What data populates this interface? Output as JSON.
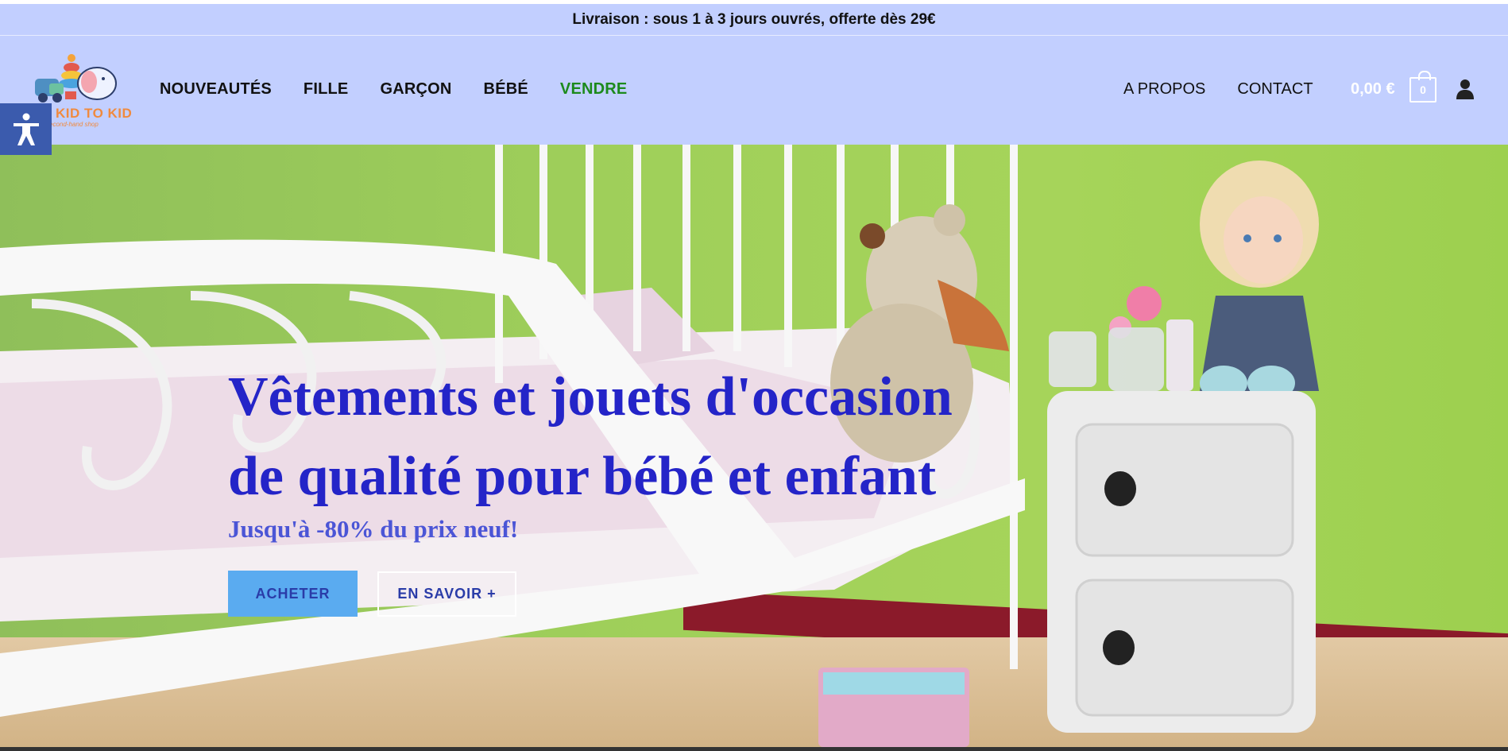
{
  "announcement": "Livraison : sous 1 à 3 jours ouvrés, offerte dès 29€",
  "logo": {
    "text": "KID TO KID",
    "subtitle": "second-hand shop"
  },
  "nav_left": [
    {
      "label": "NOUVEAUTÉS"
    },
    {
      "label": "FILLE"
    },
    {
      "label": "GARÇON"
    },
    {
      "label": "BÉBÉ"
    },
    {
      "label": "VENDRE"
    }
  ],
  "nav_right": [
    {
      "label": "A PROPOS"
    },
    {
      "label": "CONTACT"
    }
  ],
  "cart": {
    "total": "0,00 €",
    "count": "0"
  },
  "icons": {
    "accessibility": "accessibility-icon",
    "cart": "shopping-bag-icon",
    "user": "user-icon"
  },
  "hero": {
    "title_line1": "Vêtements et jouets d'occasion",
    "title_line2": "de qualité pour bébé et enfant",
    "subtitle": "Jusqu'à -80% du prix neuf!",
    "cta_primary": "ACHETER",
    "cta_secondary": "EN SAVOIR +"
  },
  "colors": {
    "header_bg": "#c2cfff",
    "nav_accent_vendre": "#1c8a1c",
    "hero_title": "#2424c8",
    "button_primary": "#5aabf0",
    "accessibility_btn": "#3b5bad"
  }
}
